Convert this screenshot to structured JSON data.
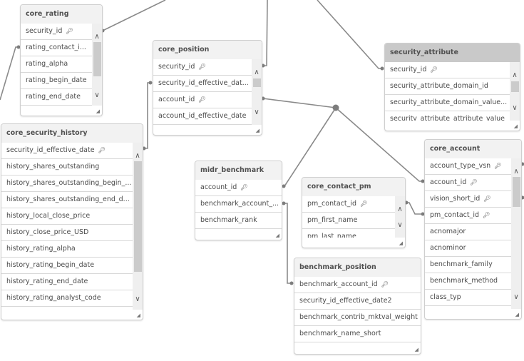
{
  "diagram": {
    "type": "data-model-viewer",
    "tables": [
      {
        "id": "core_rating",
        "name": "core_rating",
        "fields": [
          {
            "label": "security_id",
            "key": true
          },
          {
            "label": "rating_contact_i...",
            "key": false
          },
          {
            "label": "rating_alpha",
            "key": false
          },
          {
            "label": "rating_begin_date",
            "key": false
          },
          {
            "label": "rating_end_date",
            "key": false
          }
        ]
      },
      {
        "id": "core_security_history",
        "name": "core_security_history",
        "fields": [
          {
            "label": "security_id_effective_date",
            "key": true
          },
          {
            "label": "history_shares_outstanding",
            "key": false
          },
          {
            "label": "history_shares_outstanding_begin_...",
            "key": false
          },
          {
            "label": "history_shares_outstanding_end_d...",
            "key": false
          },
          {
            "label": "history_local_close_price",
            "key": false
          },
          {
            "label": "history_close_price_USD",
            "key": false
          },
          {
            "label": "history_rating_alpha",
            "key": false
          },
          {
            "label": "history_rating_begin_date",
            "key": false
          },
          {
            "label": "history_rating_end_date",
            "key": false
          },
          {
            "label": "history_rating_analyst_code",
            "key": false
          }
        ]
      },
      {
        "id": "core_position",
        "name": "core_position",
        "fields": [
          {
            "label": "security_id",
            "key": true
          },
          {
            "label": "security_id_effective_dat...",
            "key": false
          },
          {
            "label": "account_id",
            "key": true
          },
          {
            "label": "account_id_effective_date",
            "key": false
          }
        ]
      },
      {
        "id": "security_attribute",
        "name": "security_attribute",
        "selected": true,
        "fields": [
          {
            "label": "security_id",
            "key": true
          },
          {
            "label": "security_attribute_domain_id",
            "key": false
          },
          {
            "label": "security_attribute_domain_value...",
            "key": false
          },
          {
            "label": "security_attribute_attribute_value",
            "key": false
          }
        ]
      },
      {
        "id": "midr_benchmark",
        "name": "midr_benchmark",
        "fields": [
          {
            "label": "account_id",
            "key": true
          },
          {
            "label": "benchmark_account_...",
            "key": false
          },
          {
            "label": "benchmark_rank",
            "key": false
          }
        ]
      },
      {
        "id": "core_contact_pm",
        "name": "core_contact_pm",
        "fields": [
          {
            "label": "pm_contact_id",
            "key": true
          },
          {
            "label": "pm_first_name",
            "key": false
          },
          {
            "label": "pm_last_name",
            "key": false
          }
        ]
      },
      {
        "id": "core_account",
        "name": "core_account",
        "fields": [
          {
            "label": "account_type_vsn",
            "key": true
          },
          {
            "label": "account_id",
            "key": true
          },
          {
            "label": "vision_short_id",
            "key": true
          },
          {
            "label": "pm_contact_id",
            "key": true
          },
          {
            "label": "acnomajor",
            "key": false
          },
          {
            "label": "acnominor",
            "key": false
          },
          {
            "label": "benchmark_family",
            "key": false
          },
          {
            "label": "benchmark_method",
            "key": false
          },
          {
            "label": "class_typ",
            "key": false
          }
        ]
      },
      {
        "id": "benchmark_position",
        "name": "benchmark_position",
        "fields": [
          {
            "label": "benchmark_account_id",
            "key": true
          },
          {
            "label": "security_id_effective_date2",
            "key": false
          },
          {
            "label": "benchmark_contrib_mktval_weight",
            "key": false
          },
          {
            "label": "benchmark_name_short",
            "key": false
          }
        ]
      }
    ],
    "links": [
      {
        "from": "core_rating.security_id",
        "to": "offscreen-top"
      },
      {
        "from": "core_rating.rating_contact_id",
        "to": "offscreen-left"
      },
      {
        "from": "core_position.security_id",
        "to": "offscreen-top"
      },
      {
        "from": "security_attribute.security_id",
        "to": "offscreen-top"
      },
      {
        "from": "core_position.security_id_effective_date",
        "to": "core_security_history.security_id_effective_date"
      },
      {
        "from": "core_position.account_id",
        "to": "account_id-junction"
      },
      {
        "from": "midr_benchmark.account_id",
        "to": "account_id-junction"
      },
      {
        "from": "core_account.account_id",
        "to": "account_id-junction"
      },
      {
        "from": "midr_benchmark.benchmark_account_id",
        "to": "benchmark_position.benchmark_account_id"
      },
      {
        "from": "core_contact_pm.pm_contact_id",
        "to": "core_account.pm_contact_id"
      },
      {
        "from": "core_account.account_type_vsn",
        "to": "offscreen-right"
      },
      {
        "from": "core_account.vision_short_id",
        "to": "offscreen-right"
      }
    ],
    "icons": {
      "key": "key-icon",
      "scroll_up": "chevron-up-icon",
      "scroll_down": "chevron-down-icon",
      "resize": "resize-grip-icon"
    }
  }
}
